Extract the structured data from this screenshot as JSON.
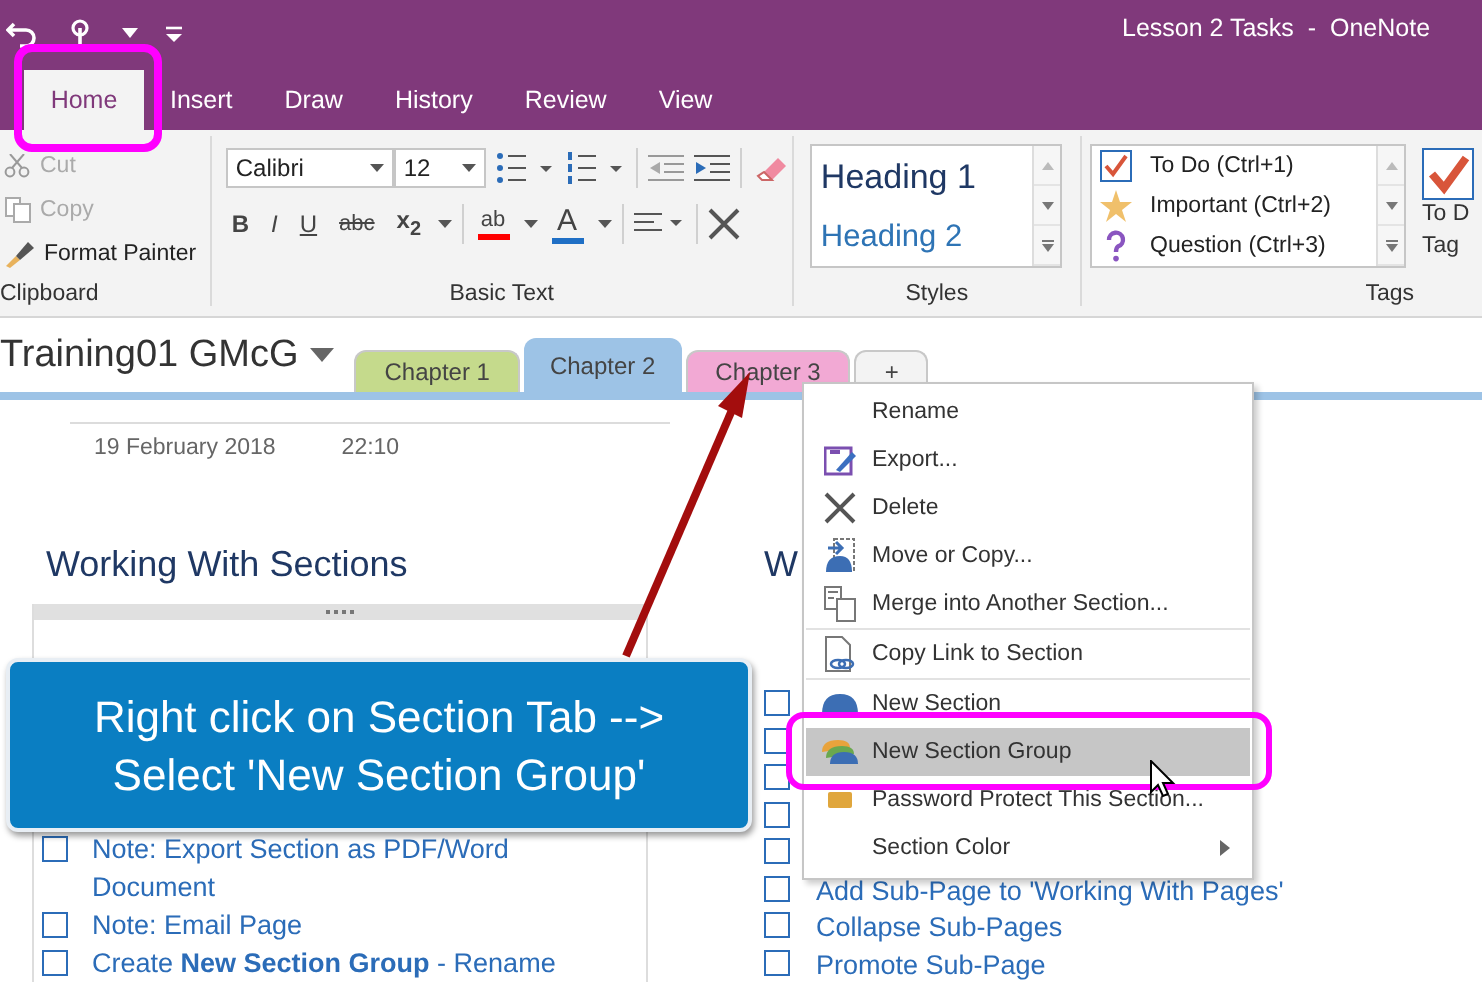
{
  "window": {
    "title": "Lesson 2 Tasks  -  OneNote"
  },
  "ribbon_tabs": [
    {
      "label": "Home",
      "selected": true
    },
    {
      "label": "Insert",
      "selected": false
    },
    {
      "label": "Draw",
      "selected": false
    },
    {
      "label": "History",
      "selected": false
    },
    {
      "label": "Review",
      "selected": false
    },
    {
      "label": "View",
      "selected": false
    }
  ],
  "clipboard": {
    "label": "Clipboard",
    "buttons": [
      {
        "label": "Cut",
        "kind": "cut",
        "disabled": true
      },
      {
        "label": "Copy",
        "kind": "copy",
        "disabled": true
      },
      {
        "label": "Format Painter",
        "kind": "painter",
        "disabled": false
      }
    ]
  },
  "basic_text": {
    "label": "Basic Text",
    "font": "Calibri",
    "size": "12",
    "format": [
      {
        "label": "B",
        "kind": "bold"
      },
      {
        "label": "I",
        "kind": "italic"
      },
      {
        "label": "U",
        "kind": "underline"
      },
      {
        "label": "abc",
        "kind": "strike"
      },
      {
        "label": "x$_{2}$",
        "kind": "subscript"
      }
    ],
    "colors": [
      {
        "label": "ab",
        "kind": "highlight",
        "color": "#ff0000"
      },
      {
        "label": "A",
        "kind": "font-color",
        "color": "#1f6fc5"
      }
    ]
  },
  "styles": {
    "label": "Styles",
    "items": [
      {
        "label": "Heading 1",
        "kind": "h1"
      },
      {
        "label": "Heading 2",
        "kind": "h2"
      }
    ]
  },
  "tags": {
    "label": "Tags",
    "items": [
      {
        "label": "To Do (Ctrl+1)",
        "kind": "todo"
      },
      {
        "label": "Important (Ctrl+2)",
        "kind": "star"
      },
      {
        "label": "Question (Ctrl+3)",
        "kind": "question"
      }
    ],
    "big_button": [
      "To D",
      "Tag"
    ]
  },
  "notebook": {
    "name": "Training01 GMcG"
  },
  "sections": [
    {
      "label": "Chapter 1",
      "color": "#c5da8c",
      "selected": false
    },
    {
      "label": "Chapter 2",
      "color": "#9dc3e6",
      "selected": true
    },
    {
      "label": "Chapter 3",
      "color": "#f2a9d4",
      "selected": false
    },
    {
      "label": "+",
      "color": "#f3f3f3",
      "selected": false
    }
  ],
  "page": {
    "date": "19 February 2018",
    "time": "22:10",
    "left": {
      "heading": "Working With Sections",
      "items": [
        {
          "text": "Note: Export Section as PDF/Word Document",
          "checked": false
        },
        {
          "text": "Note: Email Page",
          "checked": false
        },
        {
          "text": "Create **New Section Group** - Rename",
          "checked": false
        }
      ]
    },
    "right": {
      "heading": "W",
      "items": [
        {
          "checked": false
        },
        {
          "checked": false
        },
        {
          "checked": false
        },
        {
          "checked": false
        },
        {
          "checked": false
        },
        {
          "text": "Add Sub-Page to 'Working With Pages'",
          "checked": false
        },
        {
          "text": "Collapse Sub-Pages",
          "checked": false
        },
        {
          "text": "Promote Sub-Page",
          "checked": false
        }
      ]
    }
  },
  "context_menu": [
    {
      "label": "Rename",
      "kind": "plain",
      "selected": false,
      "separator_before": false,
      "submenu": false
    },
    {
      "label": "Export...",
      "kind": "export",
      "selected": false,
      "separator_before": false,
      "submenu": false
    },
    {
      "label": "Delete",
      "kind": "delete",
      "selected": false,
      "separator_before": false,
      "submenu": false
    },
    {
      "label": "Move or Copy...",
      "kind": "move",
      "selected": false,
      "separator_before": false,
      "submenu": false
    },
    {
      "label": "Merge into Another Section...",
      "kind": "merge",
      "selected": false,
      "separator_before": false,
      "submenu": false
    },
    {
      "label": "Copy Link to Section",
      "kind": "link",
      "selected": false,
      "separator_before": true,
      "submenu": false
    },
    {
      "label": "New Section",
      "kind": "section",
      "selected": false,
      "separator_before": true,
      "submenu": false
    },
    {
      "label": "New Section Group",
      "kind": "group",
      "selected": true,
      "separator_before": false,
      "submenu": false
    },
    {
      "label": "Password Protect This Section...",
      "kind": "lock",
      "selected": false,
      "separator_before": false,
      "submenu": false
    },
    {
      "label": "Section Color",
      "kind": "plain",
      "selected": false,
      "separator_before": false,
      "submenu": true
    }
  ],
  "callout": {
    "lines": [
      "Right click on Section Tab -->",
      "Select 'New Section Group'"
    ]
  }
}
